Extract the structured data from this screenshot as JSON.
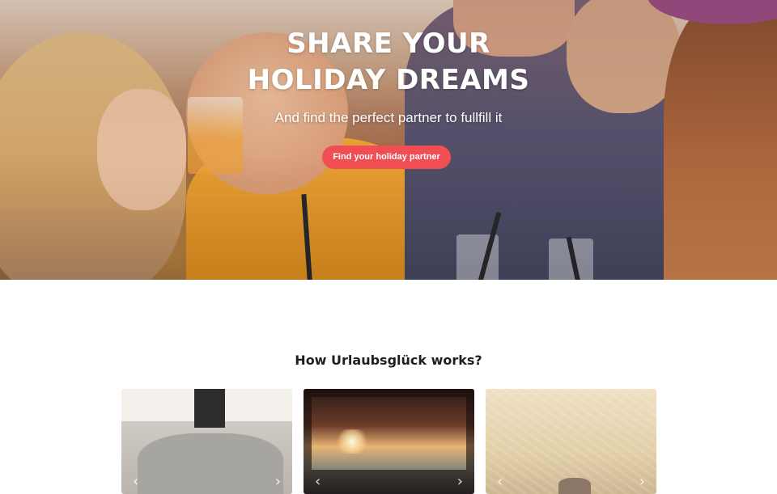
{
  "hero": {
    "title_line1": "SHARE YOUR",
    "title_line2": "HOLIDAY DREAMS",
    "subtitle": "And find the perfect partner to fullfill it",
    "cta_label": "Find your holiday partner"
  },
  "how_it_works": {
    "title": "How Urlaubsglück works?",
    "cards": [
      {
        "image": "people-sitting-photo"
      },
      {
        "image": "sunset-car-window-photo"
      },
      {
        "image": "field-photo"
      }
    ]
  },
  "colors": {
    "cta": "#f14e54",
    "hero_text": "#ffffff",
    "section_title": "#1f1f1f"
  }
}
